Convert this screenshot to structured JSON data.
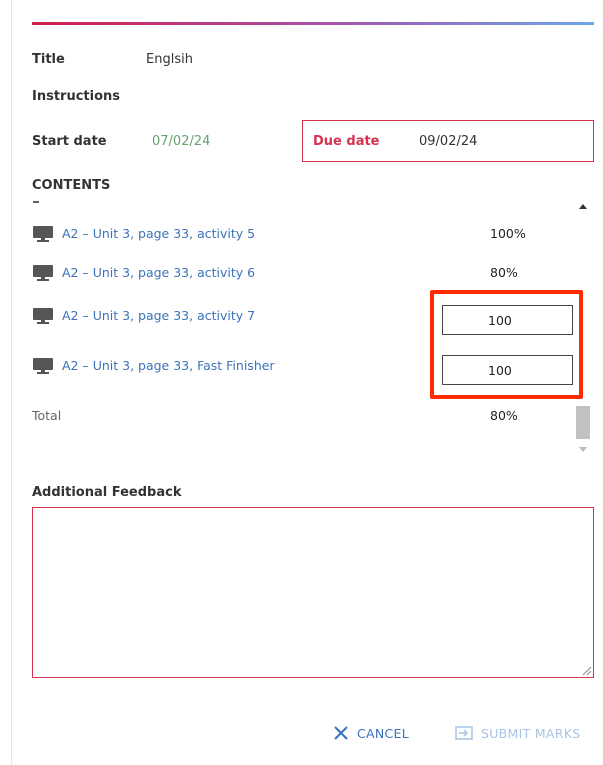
{
  "assignment": {
    "title_label": "Title",
    "title_value": "Englsih",
    "instructions_label": "Instructions",
    "start_date_label": "Start date",
    "start_date_value": "07/02/24",
    "due_date_label": "Due date",
    "due_date_value": "09/02/24"
  },
  "contents": {
    "heading": "CONTENTS",
    "rows": [
      {
        "icon": "monitor-icon",
        "label": "A2 – Unit 3, page 33, activity 5",
        "score": "100%"
      },
      {
        "icon": "monitor-icon",
        "label": "A2 – Unit 3, page 33, activity 6",
        "score": "80%"
      },
      {
        "icon": "monitor-icon",
        "label": "A2 – Unit 3, page 33, activity 7",
        "input_value": "100"
      },
      {
        "icon": "monitor-icon",
        "label": "A2 – Unit 3, page 33, Fast Finisher",
        "input_value": "100"
      }
    ],
    "total_label": "Total",
    "total_value": "80%"
  },
  "feedback": {
    "label": "Additional Feedback",
    "value": ""
  },
  "actions": {
    "cancel_label": "CANCEL",
    "submit_label": "SUBMIT MARKS"
  },
  "colors": {
    "accent_red": "#d5344f",
    "link_blue": "#3b73b9",
    "start_green": "#6aa06e",
    "highlight": "#ff2a00"
  }
}
